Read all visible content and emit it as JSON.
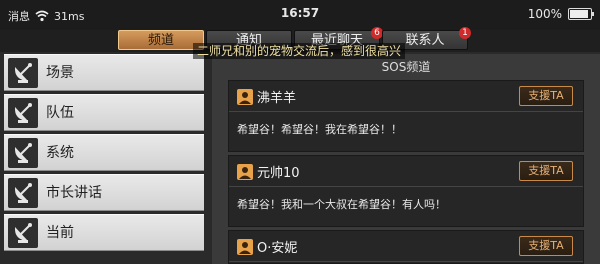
{
  "status": {
    "carrier": "消息",
    "network": "31ms",
    "time": "16:57",
    "battery_text": "100%",
    "battery_level": 1.0
  },
  "tabs": [
    {
      "label": "频道",
      "active": true
    },
    {
      "label": "通知",
      "active": false
    },
    {
      "label": "最近聊天",
      "active": false,
      "badge": "6"
    },
    {
      "label": "联系人",
      "active": false,
      "badge": "1"
    }
  ],
  "notice": "二师兄和别的宠物交流后，感到很高兴",
  "sidebar": {
    "items": [
      {
        "label": "场景"
      },
      {
        "label": "队伍"
      },
      {
        "label": "系统"
      },
      {
        "label": "市长讲话"
      },
      {
        "label": "当前"
      }
    ]
  },
  "panel": {
    "title": "SOS频道",
    "support_label": "支援TA",
    "messages": [
      {
        "name": "沸羊羊",
        "text": "希望谷！希望谷！我在希望谷！！"
      },
      {
        "name": "元帅10",
        "text": "希望谷！我和一个大叔在希望谷！有人吗！"
      },
      {
        "name": "O·安妮",
        "text": ""
      }
    ]
  },
  "colors": {
    "accent": "#c98a47",
    "badge": "#d12a2a",
    "tab_active": "#d49b5e"
  },
  "icons": {
    "wifi": "wifi-icon",
    "battery": "battery-icon",
    "nav": "satellite-dish-icon",
    "avatar": "user-icon"
  }
}
